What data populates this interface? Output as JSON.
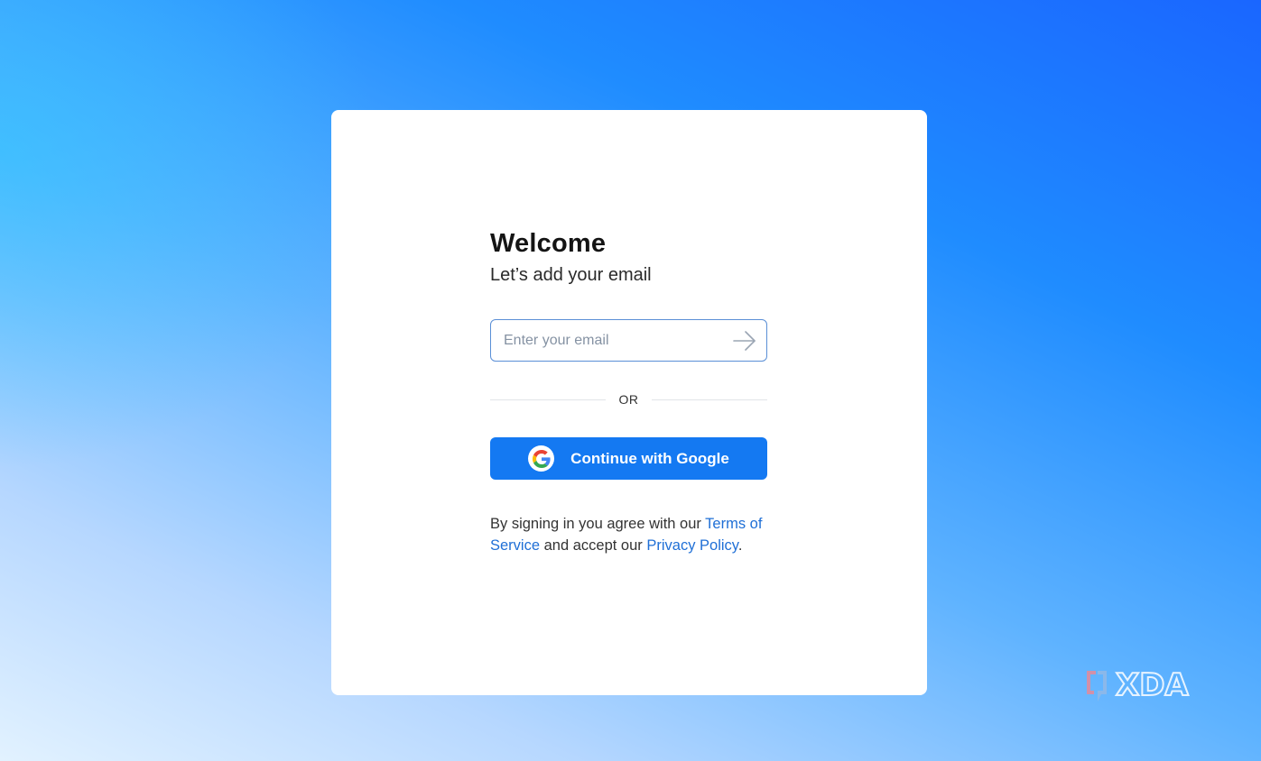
{
  "login": {
    "title": "Welcome",
    "subtitle": "Let’s add your email",
    "email_placeholder": "Enter your email",
    "email_value": "",
    "submit_icon": "arrow-right-icon",
    "divider_text": "OR",
    "google_button_label": "Continue with Google",
    "google_icon": "google-icon",
    "terms_prefix": "By signing in you agree with our ",
    "terms_link": "Terms of Service",
    "terms_middle": " and accept our ",
    "privacy_link": "Privacy Policy",
    "terms_suffix": "."
  },
  "watermark": {
    "text": "XDA"
  },
  "colors": {
    "primary_button": "#1479f2",
    "link": "#1f6fd6",
    "input_border": "#5a8fd6",
    "background_top": "#1a66ff",
    "background_bottom": "#e2f2ff"
  }
}
